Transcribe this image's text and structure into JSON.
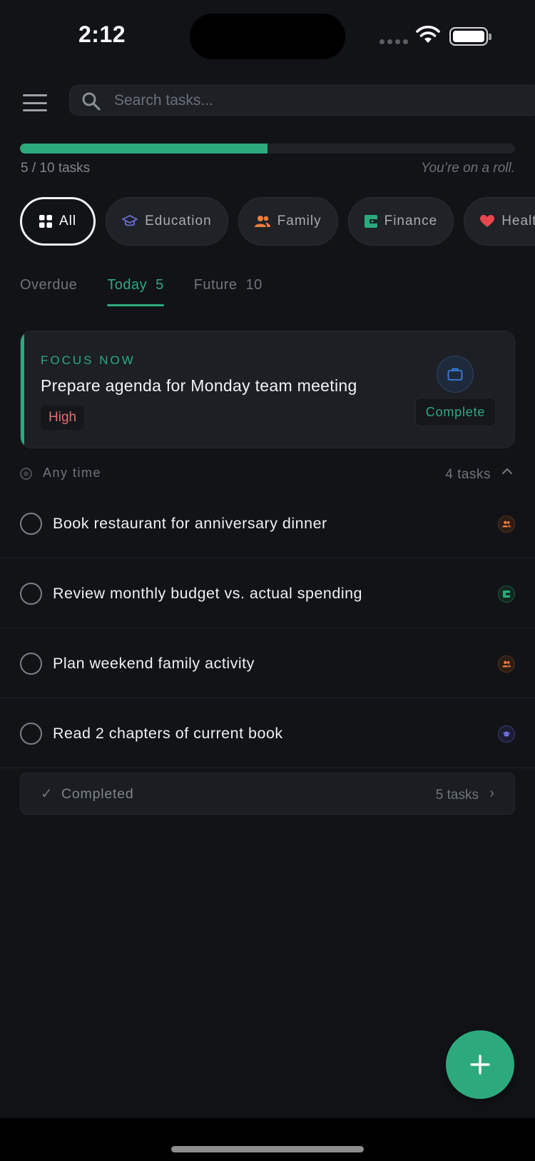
{
  "status_bar": {
    "time": "2:12"
  },
  "search": {
    "placeholder": "Search tasks..."
  },
  "progress": {
    "done": 5,
    "total": 10,
    "fraction": 0.5,
    "label": "5 / 10 tasks",
    "message": "You’re on a roll."
  },
  "categories": [
    {
      "label": "All",
      "icon": "grid-icon",
      "active": true
    },
    {
      "label": "Education",
      "icon": "graduation-cap-icon",
      "color": "#6b6fd6"
    },
    {
      "label": "Family",
      "icon": "people-icon",
      "color": "#ee7d3b"
    },
    {
      "label": "Finance",
      "icon": "wallet-icon",
      "color": "#2daa7d"
    },
    {
      "label": "Health",
      "icon": "heart-icon",
      "color": "#e5484d"
    }
  ],
  "tabs": [
    {
      "label": "Overdue",
      "count": ""
    },
    {
      "label": "Today",
      "count": "5",
      "active": true
    },
    {
      "label": "Future",
      "count": "10"
    }
  ],
  "focus": {
    "label": "FOCUS NOW",
    "title": "Prepare agenda for Monday team meeting",
    "priority": "High",
    "icon": "briefcase-icon",
    "button": "Complete"
  },
  "section": {
    "title": "Any time",
    "count": "4 tasks"
  },
  "tasks": [
    {
      "text": "Book restaurant for anniversary dinner",
      "category": "Family",
      "icon": "people-icon"
    },
    {
      "text": "Review monthly budget vs. actual spending",
      "category": "Finance",
      "icon": "wallet-icon"
    },
    {
      "text": "Plan weekend family activity",
      "category": "Family",
      "icon": "people-icon"
    },
    {
      "text": "Read 2 chapters of current book",
      "category": "Education",
      "icon": "graduation-cap-icon"
    }
  ],
  "completed": {
    "check": "✓",
    "label": "Completed",
    "count": "5 tasks",
    "chevron": "›"
  },
  "colors": {
    "accent": "#2daa7d",
    "background": "#111317",
    "priority_high": "#e0706e"
  }
}
